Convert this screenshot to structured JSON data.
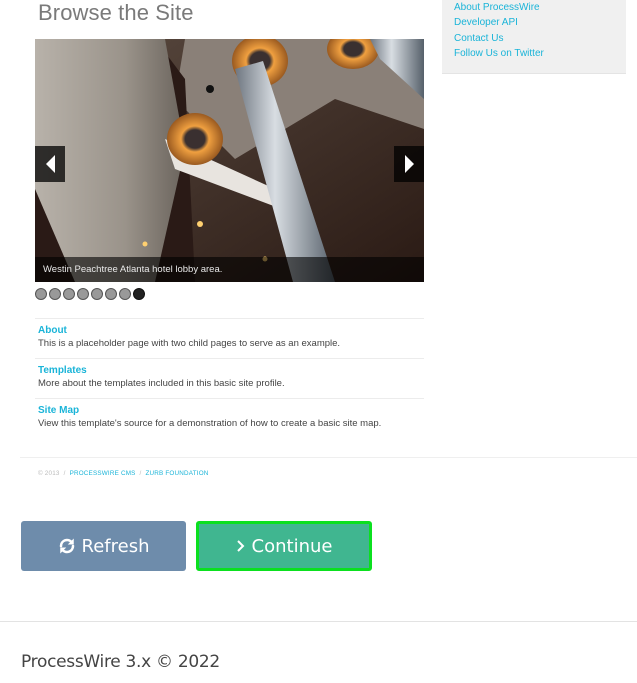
{
  "embedded_page": {
    "title": "Browse the Site",
    "sidebar_links": [
      {
        "label": "About ProcessWire"
      },
      {
        "label": "Developer API"
      },
      {
        "label": "Contact Us"
      },
      {
        "label": "Follow Us on Twitter"
      }
    ],
    "slider": {
      "caption": "Westin Peachtree Atlanta hotel lobby area.",
      "prev_icon": "triangle-left-icon",
      "next_icon": "triangle-right-icon",
      "slide_count": 8,
      "active_slide": 8
    },
    "nav_items": [
      {
        "title": "About",
        "description": "This is a placeholder page with two child pages to serve as an example."
      },
      {
        "title": "Templates",
        "description": "More about the templates included in this basic site profile."
      },
      {
        "title": "Site Map",
        "description": "View this template's source for a demonstration of how to create a basic site map."
      }
    ],
    "footer": {
      "copyright": "© 2013",
      "separator": "/",
      "links": [
        "PROCESSWIRE CMS",
        "ZURB FOUNDATION"
      ]
    },
    "colors": {
      "link": "#1ab4d8",
      "title": "#7a7a7a"
    }
  },
  "actions": {
    "refresh_label": "Refresh",
    "refresh_icon": "refresh-icon",
    "continue_label": "Continue",
    "continue_icon": "chevron-right-icon",
    "colors": {
      "refresh_bg": "#6e8cab",
      "continue_bg": "#40b690",
      "continue_highlight": "#0be01f"
    }
  },
  "footer": {
    "text": "ProcessWire 3.x © 2022"
  }
}
